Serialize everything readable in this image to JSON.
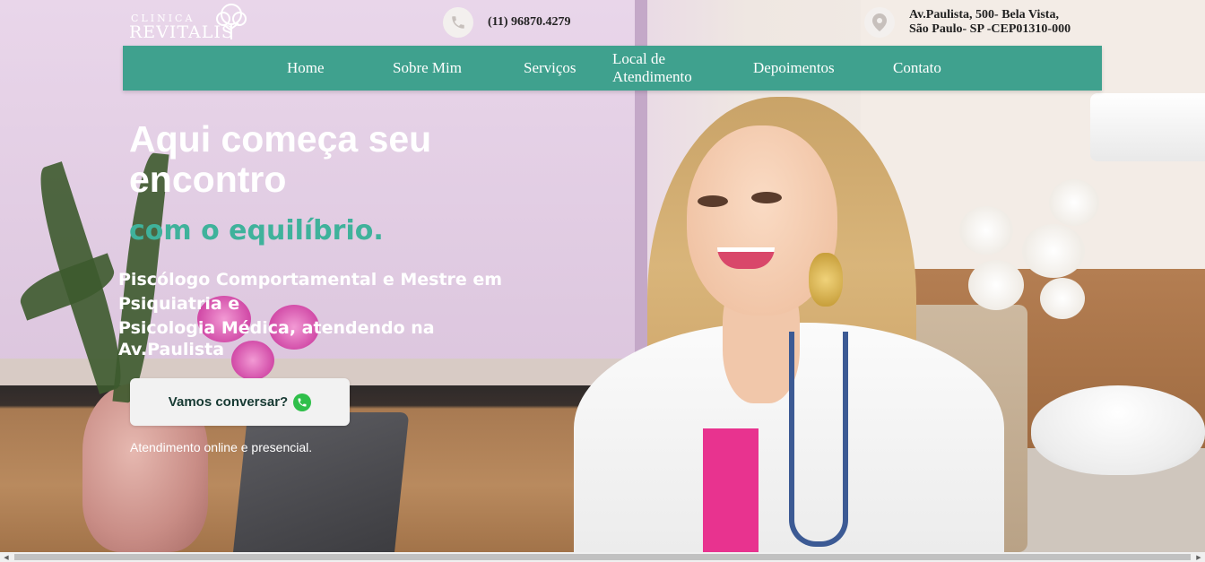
{
  "logo": {
    "small_text": "CLINICA",
    "main_text": "REVITALIS",
    "icon": "tree-icon"
  },
  "header": {
    "phone": {
      "icon": "phone-icon",
      "text": "(11) 96870.4279"
    },
    "address": {
      "icon": "location-pin-icon",
      "line1": "Av.Paulista, 500- Bela Vista,",
      "line2": "São Paulo- SP -CEP01310-000"
    }
  },
  "nav": {
    "items": [
      {
        "label": "Home"
      },
      {
        "label": "Sobre Mim"
      },
      {
        "label": "Serviços"
      },
      {
        "label_line1": "Local de",
        "label_line2": "Atendimento"
      },
      {
        "label": "Depoimentos"
      },
      {
        "label": "Contato"
      }
    ]
  },
  "hero": {
    "headline": "Aqui começa seu encontro",
    "subheadline": "com o equilíbrio.",
    "description_line1": "Piscólogo Comportamental e Mestre em",
    "description_line2": "Psiquiatria e",
    "description_line3": "Psicologia Médica, atendendo na",
    "description_line4": "Av.Paulista",
    "cta_label": "Vamos conversar?",
    "cta_icon": "whatsapp-icon",
    "note": "Atendimento online e presencial."
  },
  "colors": {
    "accent": "#3fa18e",
    "subheadline": "#3fb29b",
    "cta_bg": "#f2f2f2",
    "whatsapp": "#2fbf4a"
  }
}
